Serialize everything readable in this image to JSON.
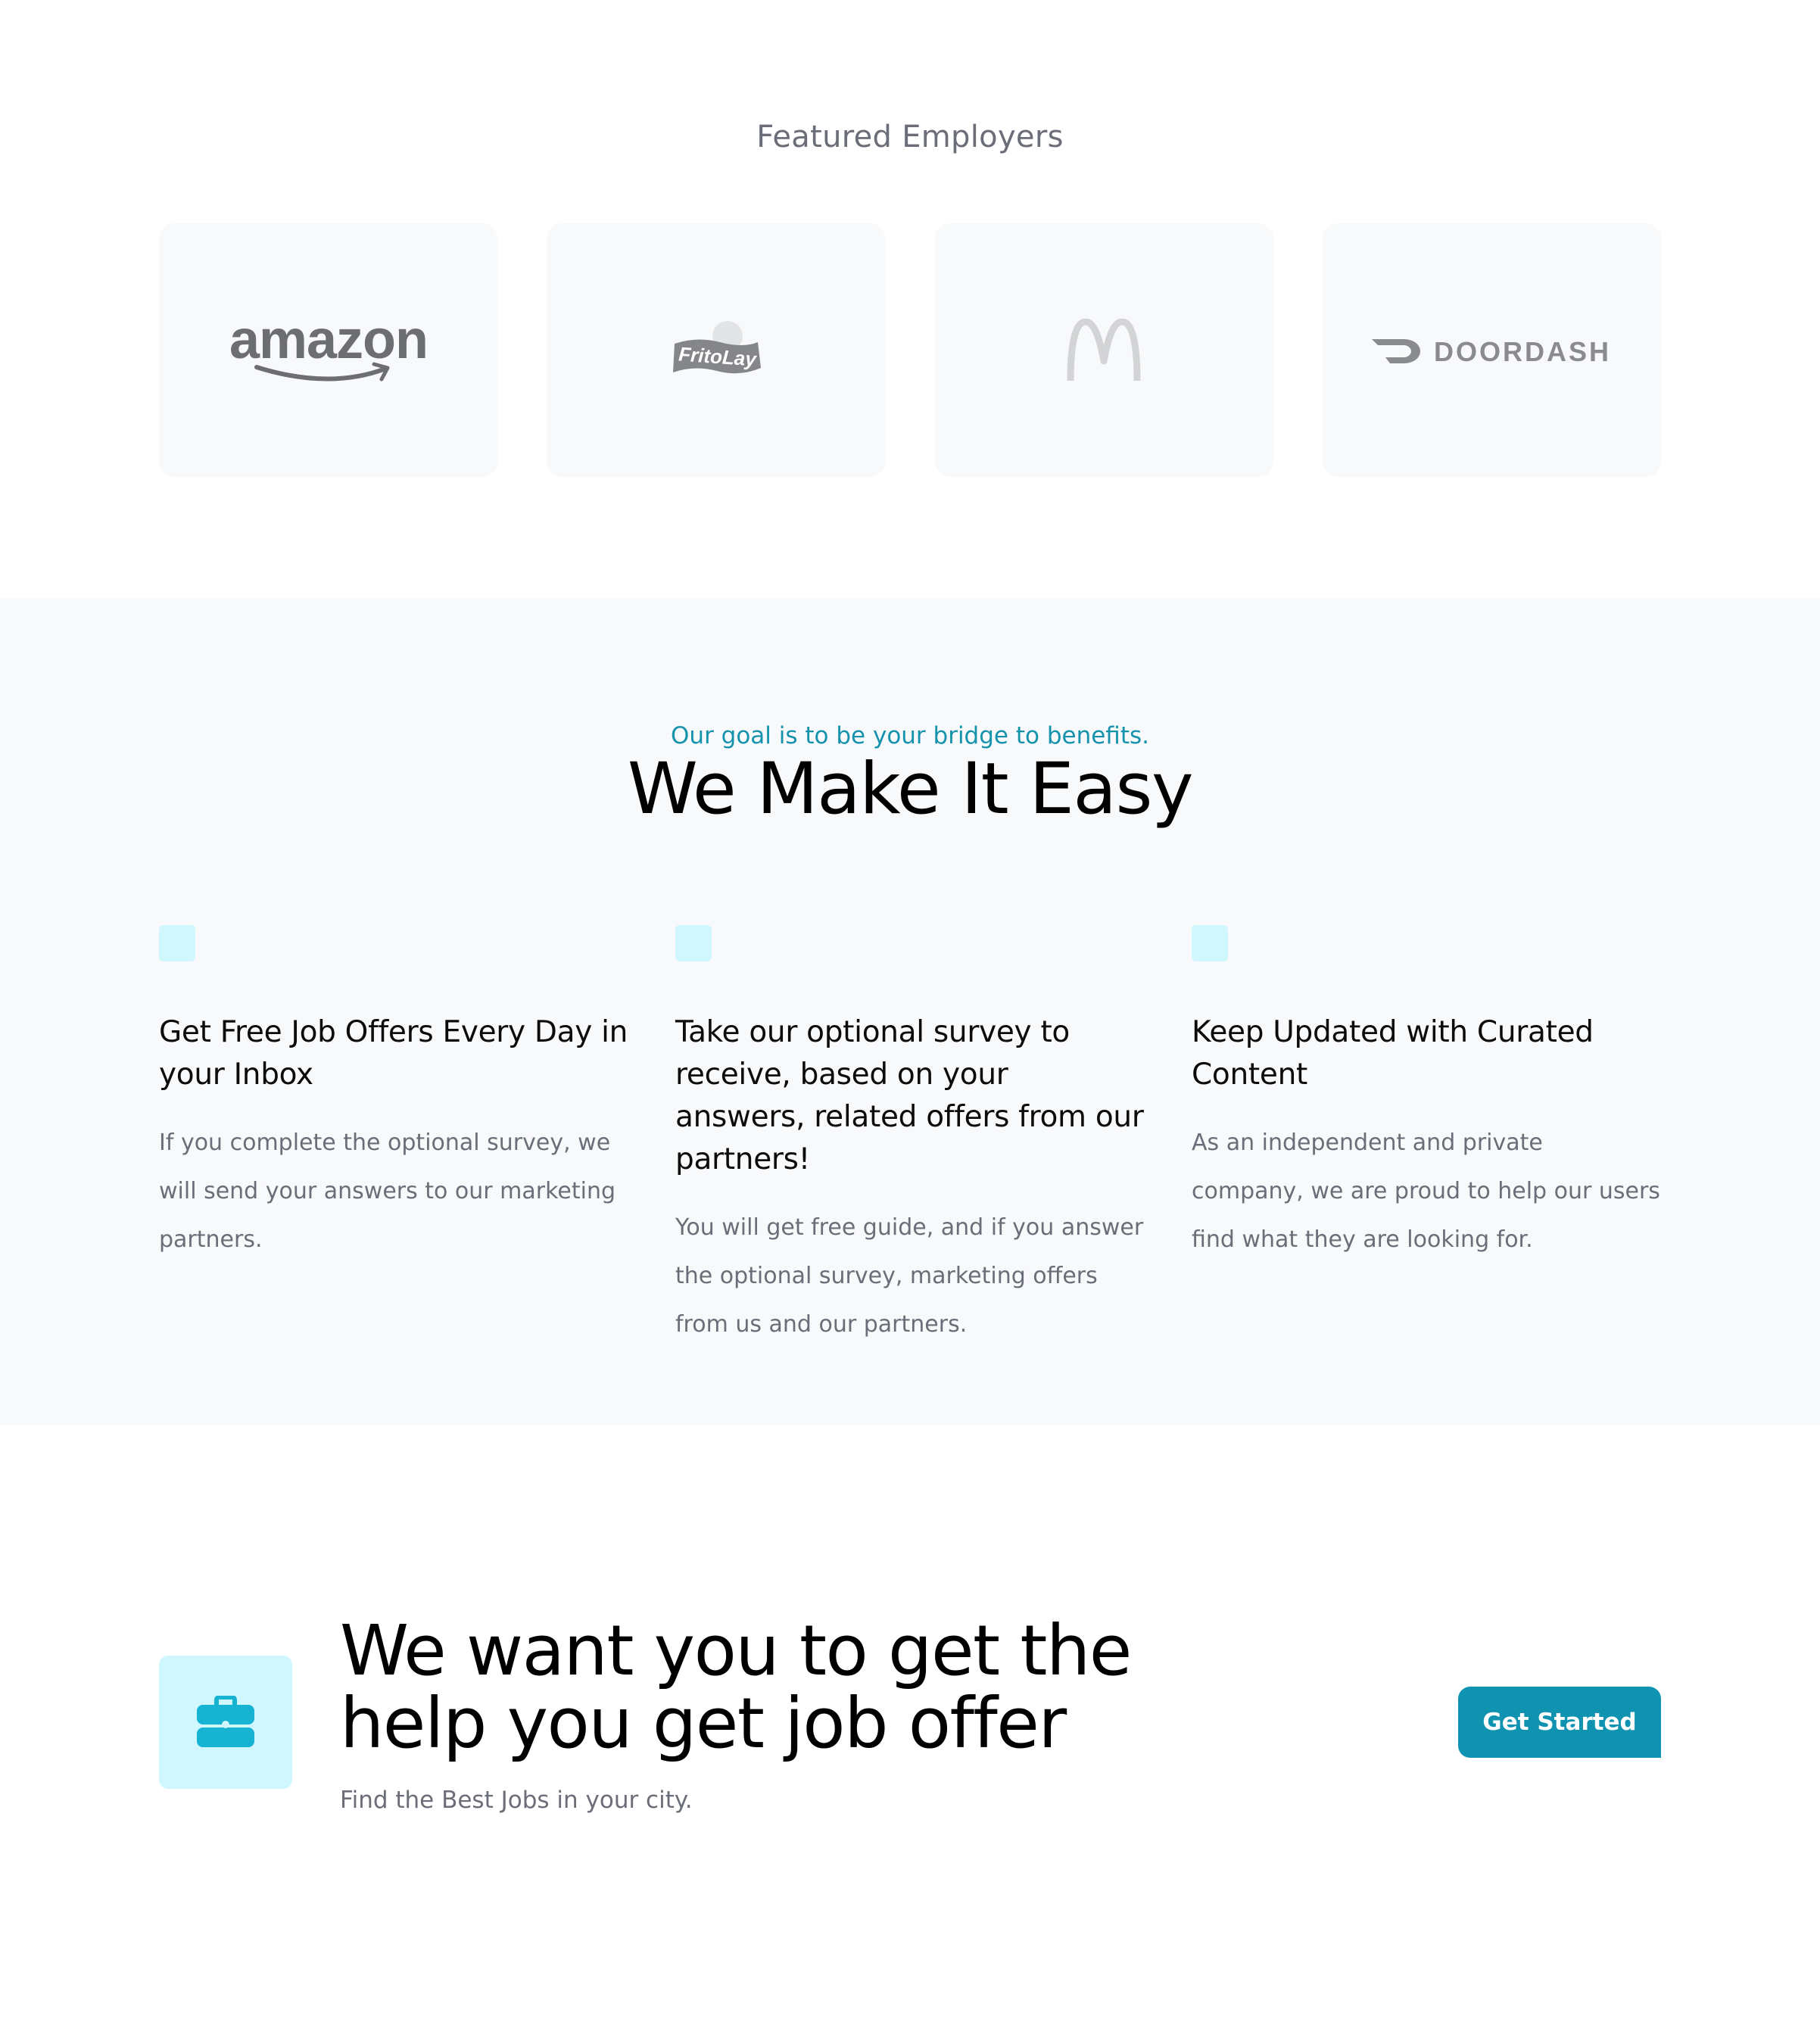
{
  "employers": {
    "title": "Featured Employers",
    "logos": [
      {
        "name": "amazon",
        "text": "amazon"
      },
      {
        "name": "fritolay",
        "text": "FritoLay"
      },
      {
        "name": "mcdonalds",
        "text": ""
      },
      {
        "name": "doordash",
        "text": "DOORDASH"
      }
    ]
  },
  "easy": {
    "tagline": "Our goal is to be your bridge to benefits.",
    "title": "We Make It Easy",
    "features": [
      {
        "title": "Get Free Job Offers Every Day in your Inbox",
        "desc": "If you complete the optional survey, we will send your answers to our marketing partners."
      },
      {
        "title": "Take our optional survey to receive, based on your answers, related offers from our partners!",
        "desc": "You will get free guide, and if you answer the optional survey, marketing offers from us and our partners."
      },
      {
        "title": "Keep Updated with Curated Content",
        "desc": "As an independent and private company, we are proud to help our users find what they are looking for."
      }
    ]
  },
  "cta": {
    "icon": "briefcase-icon",
    "title": "We want you to get the help you get job offer",
    "subtitle": "Find the Best Jobs in your city.",
    "button_label": "Get Started"
  },
  "colors": {
    "accent": "#0f93b0",
    "accent_light": "#cff7fd",
    "tagline": "#1593ad",
    "muted_text": "#6b6e78",
    "card_bg": "#f8f9fa"
  }
}
